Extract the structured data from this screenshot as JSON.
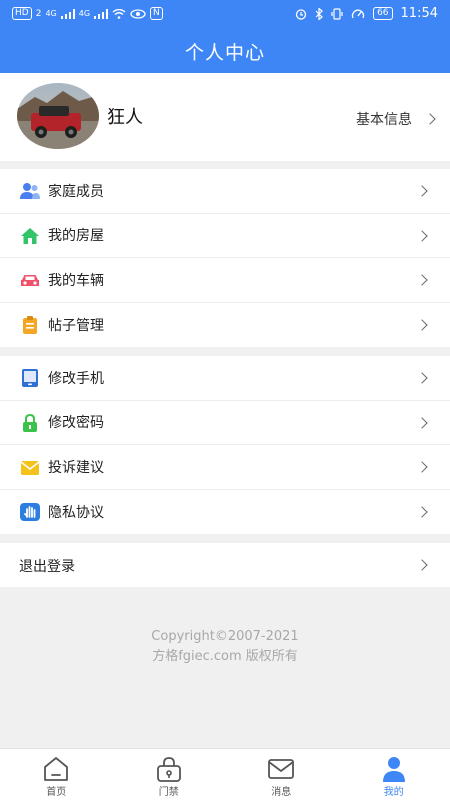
{
  "status_bar": {
    "hd_badge": "HD",
    "hd_num": "2",
    "sig1": "4G",
    "sig2": "4G",
    "nfc": "N",
    "battery": "66",
    "time": "11:54"
  },
  "header": {
    "title": "个人中心"
  },
  "profile": {
    "name": "狂人",
    "info_link": "基本信息"
  },
  "menu_group_1": [
    {
      "label": "家庭成员",
      "icon": "family-members-icon",
      "color": "#4a7ff0"
    },
    {
      "label": "我的房屋",
      "icon": "house-icon",
      "color": "#33c46a"
    },
    {
      "label": "我的车辆",
      "icon": "car-icon",
      "color": "#f0506a"
    },
    {
      "label": "帖子管理",
      "icon": "clipboard-icon",
      "color": "#f5a623"
    }
  ],
  "menu_group_2": [
    {
      "label": "修改手机",
      "icon": "phone-icon",
      "color": "#2f6fd6"
    },
    {
      "label": "修改密码",
      "icon": "lock-icon",
      "color": "#3bc24a"
    },
    {
      "label": "投诉建议",
      "icon": "envelope-icon",
      "color": "#f3c21b"
    },
    {
      "label": "隐私协议",
      "icon": "hand-icon",
      "color": "#2e7de0"
    }
  ],
  "logout": {
    "label": "退出登录"
  },
  "copyright": {
    "line1": "Copyright©2007-2021",
    "line2": "方格fgiec.com 版权所有"
  },
  "tabbar": [
    {
      "label": "首页",
      "icon": "home-icon",
      "active": false
    },
    {
      "label": "门禁",
      "icon": "access-control-icon",
      "active": false
    },
    {
      "label": "消息",
      "icon": "mail-icon",
      "active": false
    },
    {
      "label": "我的",
      "icon": "user-icon",
      "active": true
    }
  ],
  "colors": {
    "primary": "#3e86f5",
    "background": "#f0f0f0"
  }
}
